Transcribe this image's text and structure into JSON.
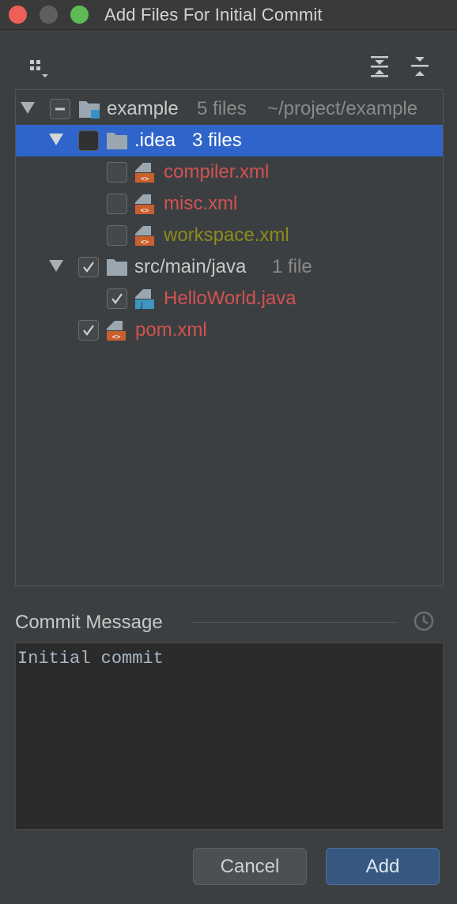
{
  "window": {
    "title": "Add Files For Initial Commit"
  },
  "toolbar": {
    "group_icon": "group-by-icon",
    "expand_icon": "expand-all-icon",
    "collapse_icon": "collapse-all-icon"
  },
  "tree": {
    "root": {
      "name": "example",
      "count": "5 files",
      "path": "~/project/example",
      "state": "partial"
    },
    "idea": {
      "name": ".idea",
      "count": "3 files",
      "state": "unchecked",
      "selected": true
    },
    "files_idea": [
      {
        "name": "compiler.xml",
        "state": "unchecked",
        "status": "unversioned"
      },
      {
        "name": "misc.xml",
        "state": "unchecked",
        "status": "unversioned"
      },
      {
        "name": "workspace.xml",
        "state": "unchecked",
        "status": "ignored"
      }
    ],
    "src": {
      "name": "src/main/java",
      "count": "1 file",
      "state": "checked"
    },
    "java_file": {
      "name": "HelloWorld.java",
      "state": "checked",
      "status": "unversioned"
    },
    "pom": {
      "name": "pom.xml",
      "state": "checked",
      "status": "unversioned"
    }
  },
  "commit": {
    "label": "Commit Message",
    "history_icon": "clock-icon",
    "message": "Initial commit"
  },
  "buttons": {
    "cancel": "Cancel",
    "add": "Add"
  },
  "colors": {
    "background": "#3c3f41",
    "selection": "#2f65ca",
    "unversioned": "#d25252",
    "ignored": "#8c8c1c",
    "primary_button": "#365880"
  }
}
